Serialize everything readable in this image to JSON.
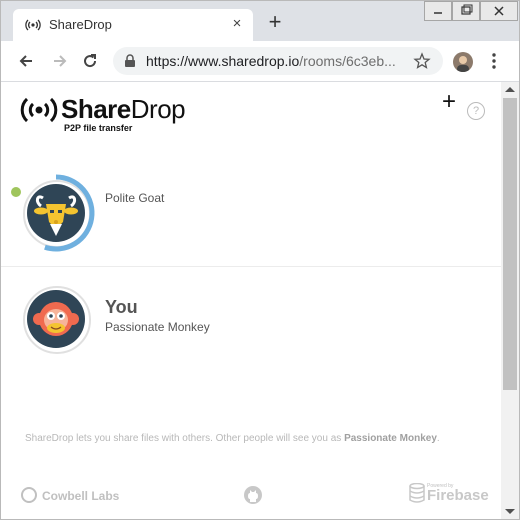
{
  "browser": {
    "tab_title": "ShareDrop",
    "tab_close": "×",
    "new_tab": "+",
    "url_host": "https://www.sharedrop.io",
    "url_path": "/rooms/6c3eb...",
    "icons": [
      "radio-waves-icon",
      "back-icon",
      "forward-icon",
      "reload-icon",
      "lock-icon",
      "star-icon",
      "profile-avatar",
      "menu-icon",
      "minimize-icon",
      "maximize-icon",
      "close-icon"
    ]
  },
  "app": {
    "logo_bold": "Share",
    "logo_rest": "Drop",
    "tagline": "P2P file transfer",
    "add_button": "+",
    "help_button": "?"
  },
  "peers": [
    {
      "name": "Polite Goat",
      "status": "online",
      "transfer_progress": 0.55,
      "avatar": "goat-icon"
    }
  ],
  "you": {
    "label": "You",
    "name": "Passionate Monkey",
    "avatar": "monkey-icon"
  },
  "footer": {
    "info_prefix": "ShareDrop lets you share files with others. Other people will see you as ",
    "info_name": "Passionate Monkey",
    "info_suffix": ".",
    "cowbell": "Cowbell Labs",
    "powered_by": "Powered by",
    "firebase": "Firebase"
  },
  "colors": {
    "avatar_bg": "#2f4556",
    "progress_arc": "#6fb0df",
    "online": "#9fc55c",
    "goat": "#f4c430",
    "monkey": "#f06a4f"
  }
}
